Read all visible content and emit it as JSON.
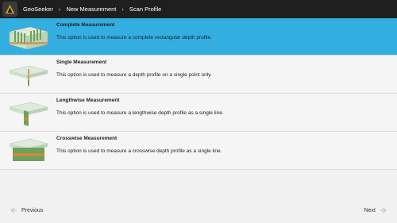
{
  "header": {
    "app_name": "GeoSeeker",
    "breadcrumb": [
      "New Measurement",
      "Scan Profile"
    ]
  },
  "options": [
    {
      "title": "Complete Measurement",
      "description": "This option is used to measure a complete rectangular depth profile.",
      "selected": true
    },
    {
      "title": "Single Measurement",
      "description": "This option is used to measure a depth profile on a single point only.",
      "selected": false
    },
    {
      "title": "Lengthwise Measurement",
      "description": "This option is used to measure a lengthwise depth profile as a single line.",
      "selected": false
    },
    {
      "title": "Crosswise Measurement",
      "description": "This option is used to measure a crosswise depth profile as a single line.",
      "selected": false
    }
  ],
  "footer": {
    "previous_label": "Previous",
    "next_label": "Next"
  },
  "colors": {
    "selected_row": "#33aee1",
    "topbar": "#1f1f1f"
  }
}
